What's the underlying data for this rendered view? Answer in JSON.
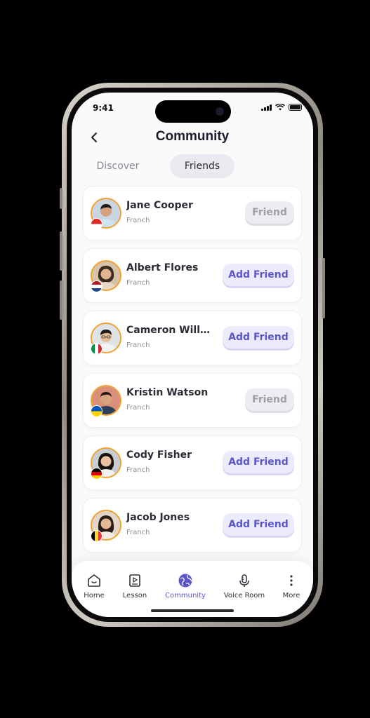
{
  "status_bar": {
    "time": "9:41"
  },
  "header": {
    "title": "Community"
  },
  "tabs": [
    {
      "label": "Discover",
      "active": false
    },
    {
      "label": "Friends",
      "active": true
    }
  ],
  "friends": [
    {
      "name": "Jane Cooper",
      "language": "Franch",
      "button": "Friend",
      "button_state": "friend",
      "flag": "indonesia-flag-icon"
    },
    {
      "name": "Albert Flores",
      "language": "Franch",
      "button": "Add Friend",
      "button_state": "add",
      "flag": "netherlands-flag-icon"
    },
    {
      "name": "Cameron Williamson",
      "language": "Franch",
      "button": "Add Friend",
      "button_state": "add",
      "flag": "italy-flag-icon"
    },
    {
      "name": "Kristin Watson",
      "language": "Franch",
      "button": "Friend",
      "button_state": "friend",
      "flag": "ukraine-flag-icon"
    },
    {
      "name": "Cody Fisher",
      "language": "Franch",
      "button": "Add Friend",
      "button_state": "add",
      "flag": "germany-flag-icon"
    },
    {
      "name": "Jacob Jones",
      "language": "Franch",
      "button": "Add Friend",
      "button_state": "add",
      "flag": "belgium-flag-icon"
    }
  ],
  "tabbar": {
    "items": [
      {
        "label": "Home",
        "icon": "home-icon",
        "active": false
      },
      {
        "label": "Lesson",
        "icon": "lesson-icon",
        "active": false
      },
      {
        "label": "Community",
        "icon": "community-globe-icon",
        "active": true
      },
      {
        "label": "Voice Room",
        "icon": "microphone-icon",
        "active": false
      },
      {
        "label": "More",
        "icon": "more-vertical-icon",
        "active": false
      }
    ]
  },
  "colors": {
    "accent": "#5b57c8",
    "avatar_ring": "#f2a12d",
    "background": "#fafafa"
  }
}
